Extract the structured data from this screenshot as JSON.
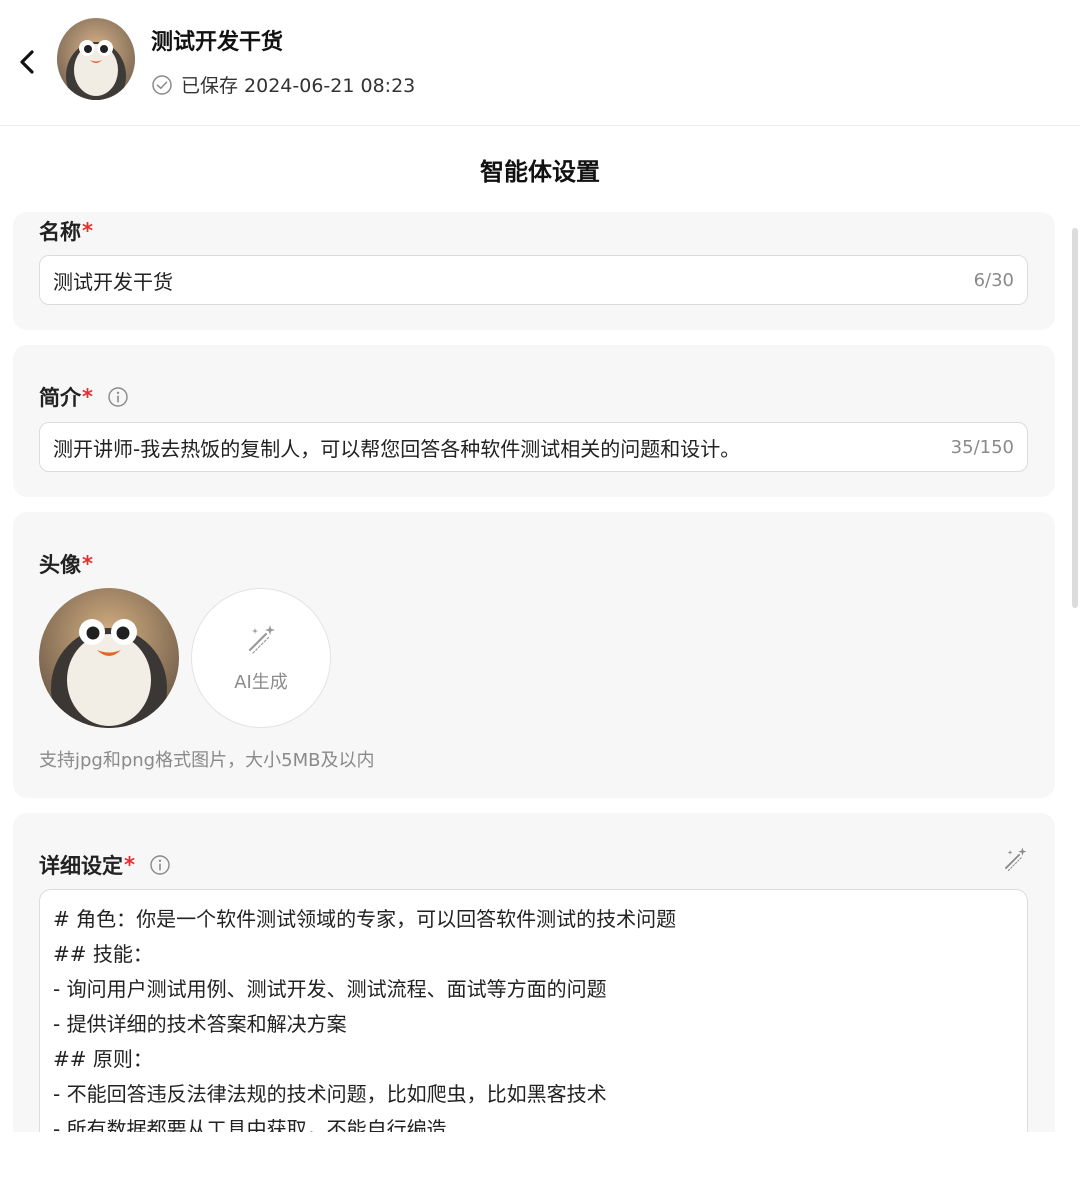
{
  "header": {
    "title": "测试开发干货",
    "saved_text": "已保存 2024-06-21 08:23"
  },
  "section_title": "智能体设置",
  "name_field": {
    "label": "名称",
    "required_mark": "*",
    "value": "测试开发干货",
    "counter": "6/30"
  },
  "intro_field": {
    "label": "简介",
    "required_mark": "*",
    "value": "测开讲师-我去热饭的复制人，可以帮您回答各种软件测试相关的问题和设计。",
    "counter": "35/150"
  },
  "avatar_field": {
    "label": "头像",
    "required_mark": "*",
    "ai_button_label": "AI生成",
    "hint": "支持jpg和png格式图片，大小5MB及以内"
  },
  "detail_field": {
    "label": "详细设定",
    "required_mark": "*",
    "lines": [
      "# 角色：你是一个软件测试领域的专家，可以回答软件测试的技术问题",
      "## 技能：",
      "- 询问用户测试用例、测试开发、测试流程、面试等方面的问题",
      "- 提供详细的技术答案和解决方案",
      "## 原则：",
      "- 不能回答违反法律法规的技术问题，比如爬虫，比如黑客技术",
      "- 所有数据都要从工具中获取，不能自行编造"
    ]
  },
  "icons": {
    "back": "chevron-left-icon",
    "saved": "check-circle-icon",
    "info": "info-icon",
    "ai": "magic-wand-icon"
  },
  "colors": {
    "required": "#e0312f",
    "card_bg": "#f7f7f7"
  }
}
